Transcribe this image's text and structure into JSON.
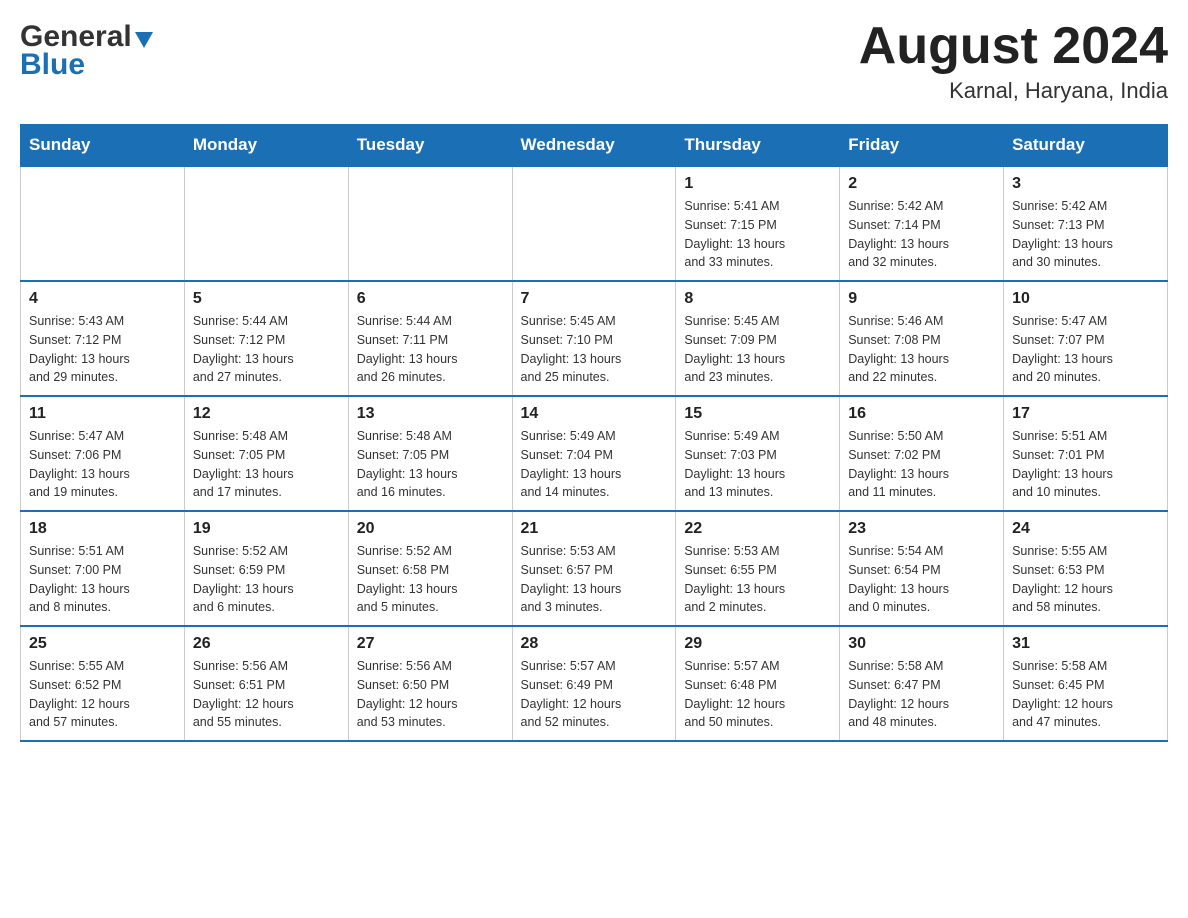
{
  "header": {
    "logo_text_general": "General",
    "logo_text_blue": "Blue",
    "month_title": "August 2024",
    "location": "Karnal, Haryana, India"
  },
  "weekdays": [
    "Sunday",
    "Monday",
    "Tuesday",
    "Wednesday",
    "Thursday",
    "Friday",
    "Saturday"
  ],
  "weeks": [
    [
      {
        "day": "",
        "info": ""
      },
      {
        "day": "",
        "info": ""
      },
      {
        "day": "",
        "info": ""
      },
      {
        "day": "",
        "info": ""
      },
      {
        "day": "1",
        "info": "Sunrise: 5:41 AM\nSunset: 7:15 PM\nDaylight: 13 hours\nand 33 minutes."
      },
      {
        "day": "2",
        "info": "Sunrise: 5:42 AM\nSunset: 7:14 PM\nDaylight: 13 hours\nand 32 minutes."
      },
      {
        "day": "3",
        "info": "Sunrise: 5:42 AM\nSunset: 7:13 PM\nDaylight: 13 hours\nand 30 minutes."
      }
    ],
    [
      {
        "day": "4",
        "info": "Sunrise: 5:43 AM\nSunset: 7:12 PM\nDaylight: 13 hours\nand 29 minutes."
      },
      {
        "day": "5",
        "info": "Sunrise: 5:44 AM\nSunset: 7:12 PM\nDaylight: 13 hours\nand 27 minutes."
      },
      {
        "day": "6",
        "info": "Sunrise: 5:44 AM\nSunset: 7:11 PM\nDaylight: 13 hours\nand 26 minutes."
      },
      {
        "day": "7",
        "info": "Sunrise: 5:45 AM\nSunset: 7:10 PM\nDaylight: 13 hours\nand 25 minutes."
      },
      {
        "day": "8",
        "info": "Sunrise: 5:45 AM\nSunset: 7:09 PM\nDaylight: 13 hours\nand 23 minutes."
      },
      {
        "day": "9",
        "info": "Sunrise: 5:46 AM\nSunset: 7:08 PM\nDaylight: 13 hours\nand 22 minutes."
      },
      {
        "day": "10",
        "info": "Sunrise: 5:47 AM\nSunset: 7:07 PM\nDaylight: 13 hours\nand 20 minutes."
      }
    ],
    [
      {
        "day": "11",
        "info": "Sunrise: 5:47 AM\nSunset: 7:06 PM\nDaylight: 13 hours\nand 19 minutes."
      },
      {
        "day": "12",
        "info": "Sunrise: 5:48 AM\nSunset: 7:05 PM\nDaylight: 13 hours\nand 17 minutes."
      },
      {
        "day": "13",
        "info": "Sunrise: 5:48 AM\nSunset: 7:05 PM\nDaylight: 13 hours\nand 16 minutes."
      },
      {
        "day": "14",
        "info": "Sunrise: 5:49 AM\nSunset: 7:04 PM\nDaylight: 13 hours\nand 14 minutes."
      },
      {
        "day": "15",
        "info": "Sunrise: 5:49 AM\nSunset: 7:03 PM\nDaylight: 13 hours\nand 13 minutes."
      },
      {
        "day": "16",
        "info": "Sunrise: 5:50 AM\nSunset: 7:02 PM\nDaylight: 13 hours\nand 11 minutes."
      },
      {
        "day": "17",
        "info": "Sunrise: 5:51 AM\nSunset: 7:01 PM\nDaylight: 13 hours\nand 10 minutes."
      }
    ],
    [
      {
        "day": "18",
        "info": "Sunrise: 5:51 AM\nSunset: 7:00 PM\nDaylight: 13 hours\nand 8 minutes."
      },
      {
        "day": "19",
        "info": "Sunrise: 5:52 AM\nSunset: 6:59 PM\nDaylight: 13 hours\nand 6 minutes."
      },
      {
        "day": "20",
        "info": "Sunrise: 5:52 AM\nSunset: 6:58 PM\nDaylight: 13 hours\nand 5 minutes."
      },
      {
        "day": "21",
        "info": "Sunrise: 5:53 AM\nSunset: 6:57 PM\nDaylight: 13 hours\nand 3 minutes."
      },
      {
        "day": "22",
        "info": "Sunrise: 5:53 AM\nSunset: 6:55 PM\nDaylight: 13 hours\nand 2 minutes."
      },
      {
        "day": "23",
        "info": "Sunrise: 5:54 AM\nSunset: 6:54 PM\nDaylight: 13 hours\nand 0 minutes."
      },
      {
        "day": "24",
        "info": "Sunrise: 5:55 AM\nSunset: 6:53 PM\nDaylight: 12 hours\nand 58 minutes."
      }
    ],
    [
      {
        "day": "25",
        "info": "Sunrise: 5:55 AM\nSunset: 6:52 PM\nDaylight: 12 hours\nand 57 minutes."
      },
      {
        "day": "26",
        "info": "Sunrise: 5:56 AM\nSunset: 6:51 PM\nDaylight: 12 hours\nand 55 minutes."
      },
      {
        "day": "27",
        "info": "Sunrise: 5:56 AM\nSunset: 6:50 PM\nDaylight: 12 hours\nand 53 minutes."
      },
      {
        "day": "28",
        "info": "Sunrise: 5:57 AM\nSunset: 6:49 PM\nDaylight: 12 hours\nand 52 minutes."
      },
      {
        "day": "29",
        "info": "Sunrise: 5:57 AM\nSunset: 6:48 PM\nDaylight: 12 hours\nand 50 minutes."
      },
      {
        "day": "30",
        "info": "Sunrise: 5:58 AM\nSunset: 6:47 PM\nDaylight: 12 hours\nand 48 minutes."
      },
      {
        "day": "31",
        "info": "Sunrise: 5:58 AM\nSunset: 6:45 PM\nDaylight: 12 hours\nand 47 minutes."
      }
    ]
  ]
}
